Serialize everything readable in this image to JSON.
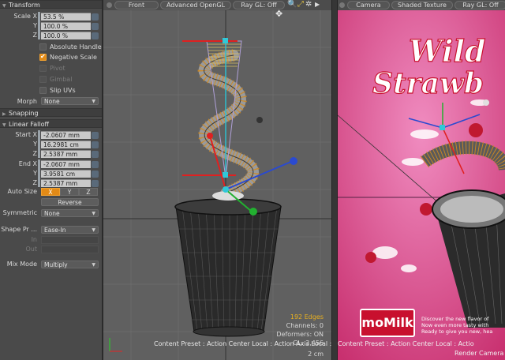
{
  "panel": {
    "transform": {
      "title": "Transform",
      "scale_label": "Scale X",
      "y_label": "Y",
      "z_label": "Z",
      "scale_x": "53.5 %",
      "scale_y": "100.0 %",
      "scale_z": "100.0 %"
    },
    "options": {
      "absolute_handle": "Absolute Handle",
      "negative_scale": "Negative Scale",
      "pivot": "Pivot",
      "gimbal": "Gimbal",
      "slip_uvs": "Slip UVs"
    },
    "morph": {
      "label": "Morph",
      "value": "None"
    },
    "snapping": {
      "title": "Snapping"
    },
    "linear_falloff": {
      "title": "Linear Falloff",
      "start_x_label": "Start X",
      "start_x": "-2.0607 mm",
      "start_y": "16.2981 cm",
      "start_z": "2.5387 mm",
      "end_x_label": "End X",
      "end_x": "-2.0607 mm",
      "end_y": "3.9581 cm",
      "end_z": "2.5387 mm",
      "auto_size_label": "Auto Size",
      "auto_x": "X",
      "auto_y": "Y",
      "auto_z": "Z",
      "reverse": "Reverse",
      "symmetric_label": "Symmetric",
      "symmetric_value": "None",
      "shape_label": "Shape Pr ...",
      "shape_value": "Ease-In",
      "in_label": "In",
      "out_label": "Out"
    },
    "mix_mode": {
      "label": "Mix Mode",
      "value": "Multiply"
    }
  },
  "viewport1": {
    "tabs": [
      "Front",
      "Advanced OpenGL",
      "Ray GL: Off"
    ],
    "edges": "192 Edges",
    "channels": "Channels: 0",
    "deformers": "Deformers: ON",
    "gl": "GL: 3,456",
    "scale": "2 cm",
    "status": "Content Preset : Action Center Local : Action Axis Local : Brush"
  },
  "viewport2": {
    "tabs": [
      "Camera",
      "Shaded Texture",
      "Ray GL: Off"
    ],
    "title_line1": "Wild",
    "title_line2": "Strawb",
    "logo": "moMilk",
    "copy_line1": "Discover the new flavor of",
    "copy_line2": "Now even more tasty with",
    "copy_line3": "Ready to give you new, hea",
    "render_camera": "Render Camera",
    "status": "Content Preset : Action Center Local : Actio"
  },
  "colors": {
    "accent_orange": "#e28a16",
    "viewport_grey": "#606060",
    "poster_pink": "#d8438c",
    "logo_red": "#c8102e"
  }
}
